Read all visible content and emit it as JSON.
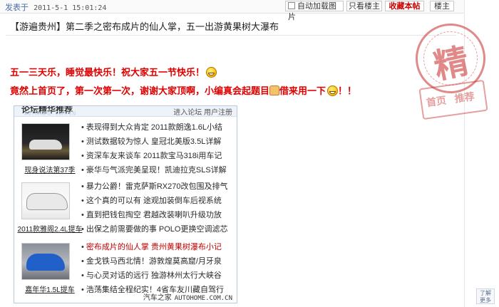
{
  "topbar": {
    "posted_label": "发表于",
    "posted_datetime": "2011-5-1 15:01:24",
    "auto_load_images_label": "自动加载图片",
    "only_host_label": "只看楼主",
    "favorite_label": "收藏本帖",
    "floor_label": "楼主"
  },
  "post": {
    "title_tag": "【游遍贵州】",
    "title_text": "第二季之密布成片的仙人掌，五一出游黄果树大瀑布",
    "line1": "五一三天乐，睡觉最快乐！祝大家五一节快乐！",
    "line2_a": "竟然上首页了，第一次第一次，谢谢大家顶啊，小编真会起题目",
    "line2_b": "借来用一下",
    "line2_end": "！！"
  },
  "stamp": {
    "main_char": "精",
    "sub_a": "首页",
    "sub_b": "推荐"
  },
  "panel": {
    "header_title": "论坛精华推荐",
    "header_right": "进入论坛  用户注册",
    "watermark": "AUTOHOME.COM.CN",
    "footer_cn": "汽车之家",
    "footer_en": "AUTOHOME.COM.CN",
    "groups": [
      {
        "caption": "现身说法第37季",
        "links": [
          {
            "text": "表现得到大众肯定 2011款朗逸1.6L小结"
          },
          {
            "text": "测试数据较为惊人 皇冠北美版3.5L详解"
          },
          {
            "text": "资深车友来谈车 2011款宝马318i用车记"
          },
          {
            "text": "豪华与气派完美呈现！凯迪拉克SLS详解"
          }
        ]
      },
      {
        "caption": "2011款雅阁2.4L提车",
        "links": [
          {
            "text": "暴力公爵！雷克萨斯RX270改包围及排气"
          },
          {
            "text": "这个真的可以有 途观加装倒车后视系统"
          },
          {
            "text": "直到把钱包掏空 君越改装喇叭升级功放"
          },
          {
            "text": "出保之前需要做的事 POLO更换空调滤芯"
          }
        ]
      },
      {
        "caption": "嘉年华1.5L提车",
        "links": [
          {
            "text": "密布成片的仙人掌 贵州黄果树瀑布小记",
            "hot": true
          },
          {
            "text": "金戈铁马西北情！游敦煌莫高窟/月牙泉"
          },
          {
            "text": "与心灵对话的远行 独游林州太行大峡谷"
          },
          {
            "text": "浩荡集结全程纪实！4省车友川藏自驾行"
          }
        ]
      }
    ]
  },
  "corner": {
    "line1": "了解",
    "line2": "更多"
  }
}
